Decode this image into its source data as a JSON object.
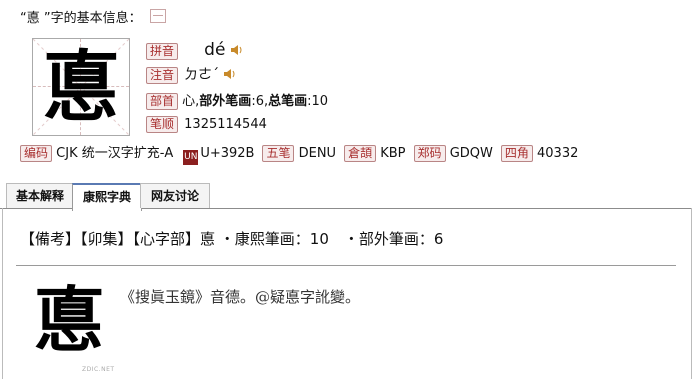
{
  "header": {
    "title": "“悳 ”字的基本信息："
  },
  "character": {
    "glyph": "悳",
    "glyph_large": "悳",
    "watermark": "ZDIC.NET"
  },
  "info": {
    "pinyin_tag": "拼音",
    "pinyin": "dé",
    "zhuyin_tag": "注音",
    "zhuyin": "ㄉㄜˊ",
    "radical_tag": "部首",
    "radical": "心,",
    "radical_strokes_label": "部外笔画",
    "radical_strokes": ":6,",
    "total_strokes_label": "总笔画",
    "total_strokes": ":10",
    "stroke_order_tag": "笔顺",
    "stroke_order": "1325114544"
  },
  "codes": [
    {
      "tag": "编码",
      "value": "CJK 统一汉字扩充-A"
    },
    {
      "tag": "UN",
      "value": "U+392B",
      "is_logo": true
    },
    {
      "tag": "五笔",
      "value": "DENU"
    },
    {
      "tag": "倉頡",
      "value": "KBP"
    },
    {
      "tag": "郑码",
      "value": "GDQW"
    },
    {
      "tag": "四角",
      "value": "40332"
    }
  ],
  "tabs": [
    {
      "label": "基本解释",
      "active": false
    },
    {
      "label": "康熙字典",
      "active": true
    },
    {
      "label": "网友讨论",
      "active": false
    }
  ],
  "kangxi": {
    "line": "【備考】【卯集】【心字部】悳 ・康熙筆画：10　・部外筆画：6",
    "quote": "《搜眞玉鏡》音德。@疑悳字訛變。"
  },
  "colors": {
    "tag_text": "#a83030",
    "tag_bg": "#f7ecec",
    "tab_accent": "#5a7ab3"
  }
}
